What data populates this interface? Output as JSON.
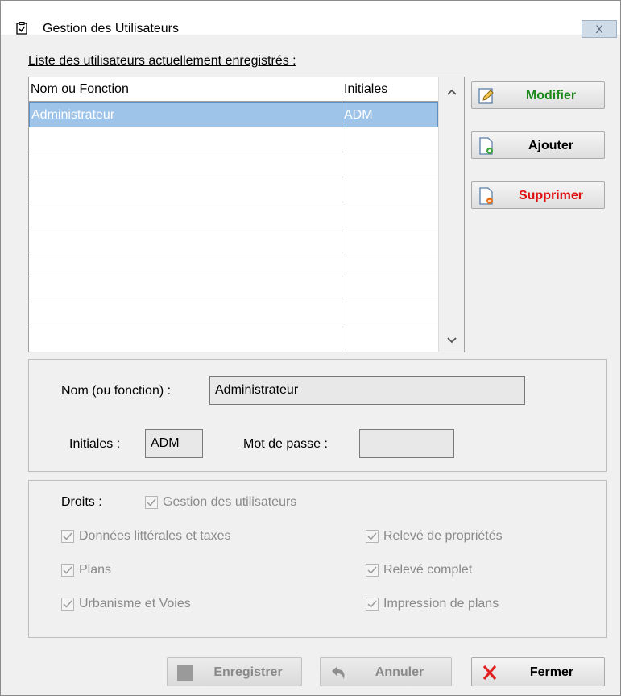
{
  "window": {
    "title": "Gestion des Utilisateurs",
    "close_symbol": "X"
  },
  "list": {
    "label": "Liste des utilisateurs actuellement enregistrés :",
    "columns": [
      "Nom ou Fonction",
      "Initiales"
    ],
    "rows": [
      {
        "name": "Administrateur",
        "initials": "ADM"
      },
      {
        "name": "",
        "initials": ""
      },
      {
        "name": "",
        "initials": ""
      },
      {
        "name": "",
        "initials": ""
      },
      {
        "name": "",
        "initials": ""
      },
      {
        "name": "",
        "initials": ""
      },
      {
        "name": "",
        "initials": ""
      },
      {
        "name": "",
        "initials": ""
      },
      {
        "name": "",
        "initials": ""
      },
      {
        "name": "",
        "initials": ""
      }
    ]
  },
  "actions": {
    "modify_label": "Modifier",
    "add_label": "Ajouter",
    "delete_label": "Supprimer"
  },
  "details": {
    "name_label": "Nom (ou fonction) :",
    "name_value": "Administrateur",
    "initials_label": "Initiales :",
    "initials_value": "ADM",
    "password_label": "Mot de passe :",
    "password_value": ""
  },
  "rights": {
    "label": "Droits :",
    "items": [
      {
        "label": "Gestion des utilisateurs",
        "checked": true
      },
      {
        "label": "Données littérales et taxes",
        "checked": true
      },
      {
        "label": "Relevé de propriétés",
        "checked": true
      },
      {
        "label": "Plans",
        "checked": true
      },
      {
        "label": "Relevé complet",
        "checked": true
      },
      {
        "label": "Urbanisme et Voies",
        "checked": true
      },
      {
        "label": "Impression de plans",
        "checked": true
      }
    ]
  },
  "footer": {
    "save_label": "Enregistrer",
    "cancel_label": "Annuler",
    "close_label": "Fermer"
  },
  "colors": {
    "modify": "#1e8a1e",
    "delete": "#e01010",
    "selection": "#9fc4ea"
  }
}
